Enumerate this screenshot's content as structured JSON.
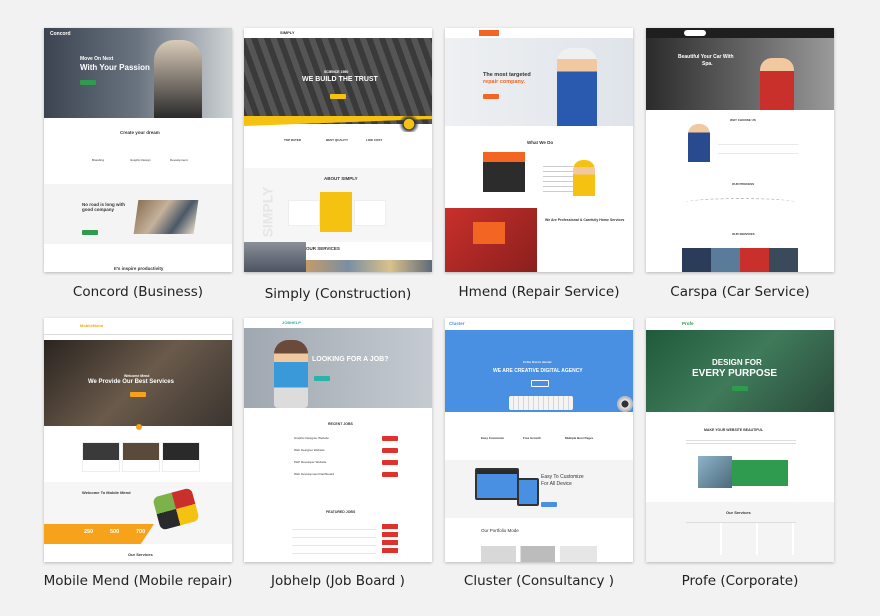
{
  "captions": [
    "Concord (Business)",
    "Simply (Construction)",
    "Hmend (Repair Service)",
    "Carspa (Car Service)",
    "Mobile Mend (Mobile repair)",
    "Jobhelp (Job Board )",
    "Cluster (Consultancy )",
    "Profe (Corporate)"
  ],
  "thumbs": {
    "concord": {
      "logo": "Concord",
      "hero_pre": "Move On Next",
      "hero": "With Your Passion",
      "sec": "Create your dream",
      "cards": [
        "Branding",
        "Graphic Design",
        "Development"
      ],
      "quote": "No road is long with good company",
      "foot": "It's inspire productivity"
    },
    "simply": {
      "logo": "SIMPLY",
      "hero_pre": "SCIENCE 1950",
      "hero": "WE BUILD THE TRUST",
      "features": [
        "TOP RATED",
        "BEST QUALITY",
        "LOW COST"
      ],
      "about": "ABOUT SIMPLY",
      "side": "SIMPLY",
      "services": "OUR SERVICES"
    },
    "hmend": {
      "logo": "HMEND",
      "hero1": "The most targeted",
      "hero2": "repair company.",
      "sec": "What We Do",
      "promo": "We Are Professional & Carefully Home Services"
    },
    "carspa": {
      "logo": "CARSPA",
      "hero1": "Beautiful Your Car With",
      "hero2": "Spa.",
      "sec1": "WHY CHOOSE US",
      "sec2": "OUR PROCESS",
      "sec3": "OUR SERVICES"
    },
    "mobilemend": {
      "logo": "MobileMend",
      "hero_pre": "Welcome Mend",
      "hero": "We Provide Our Best Services",
      "welcome": "Welcome To Mobile Mend",
      "stats": [
        "250",
        "500",
        "700"
      ],
      "services": "Our Services"
    },
    "jobhelp": {
      "logo": "JOBHELP",
      "hero": "LOOKING FOR A JOB?",
      "recent": "RECENT JOBS",
      "featured": "FEATURED JOBS",
      "jobs": [
        "Graphic Designer Website",
        "Web Designer Website",
        "PHP Developer Website",
        "Web Development Dashboard"
      ]
    },
    "cluster": {
      "logo": "Cluster",
      "hero_pre": "In the first in cluster",
      "hero": "WE ARE CREATIVE DIGITAL AGENCY",
      "feat": [
        "Easy Customize",
        "Free Growth",
        "Multiple Best Pages"
      ],
      "promo1": "Easy To Customize",
      "promo2": "For All Device",
      "portfolio": "Our Portfolio Mode"
    },
    "profe": {
      "logo": "Profe",
      "hero1": "DESIGN FOR",
      "hero2": "EVERY PURPOSE",
      "sub": "MAKE YOUR WEBSITE BEAUTIFUL",
      "services": "Our Services"
    }
  },
  "colors": {
    "bg": "#f2f2f2",
    "orange": "#f7a21b",
    "blue": "#4a90e2",
    "green": "#2e9b4e",
    "navy": "#1f2a44",
    "red": "#e0322d",
    "yellow": "#f5c211"
  }
}
